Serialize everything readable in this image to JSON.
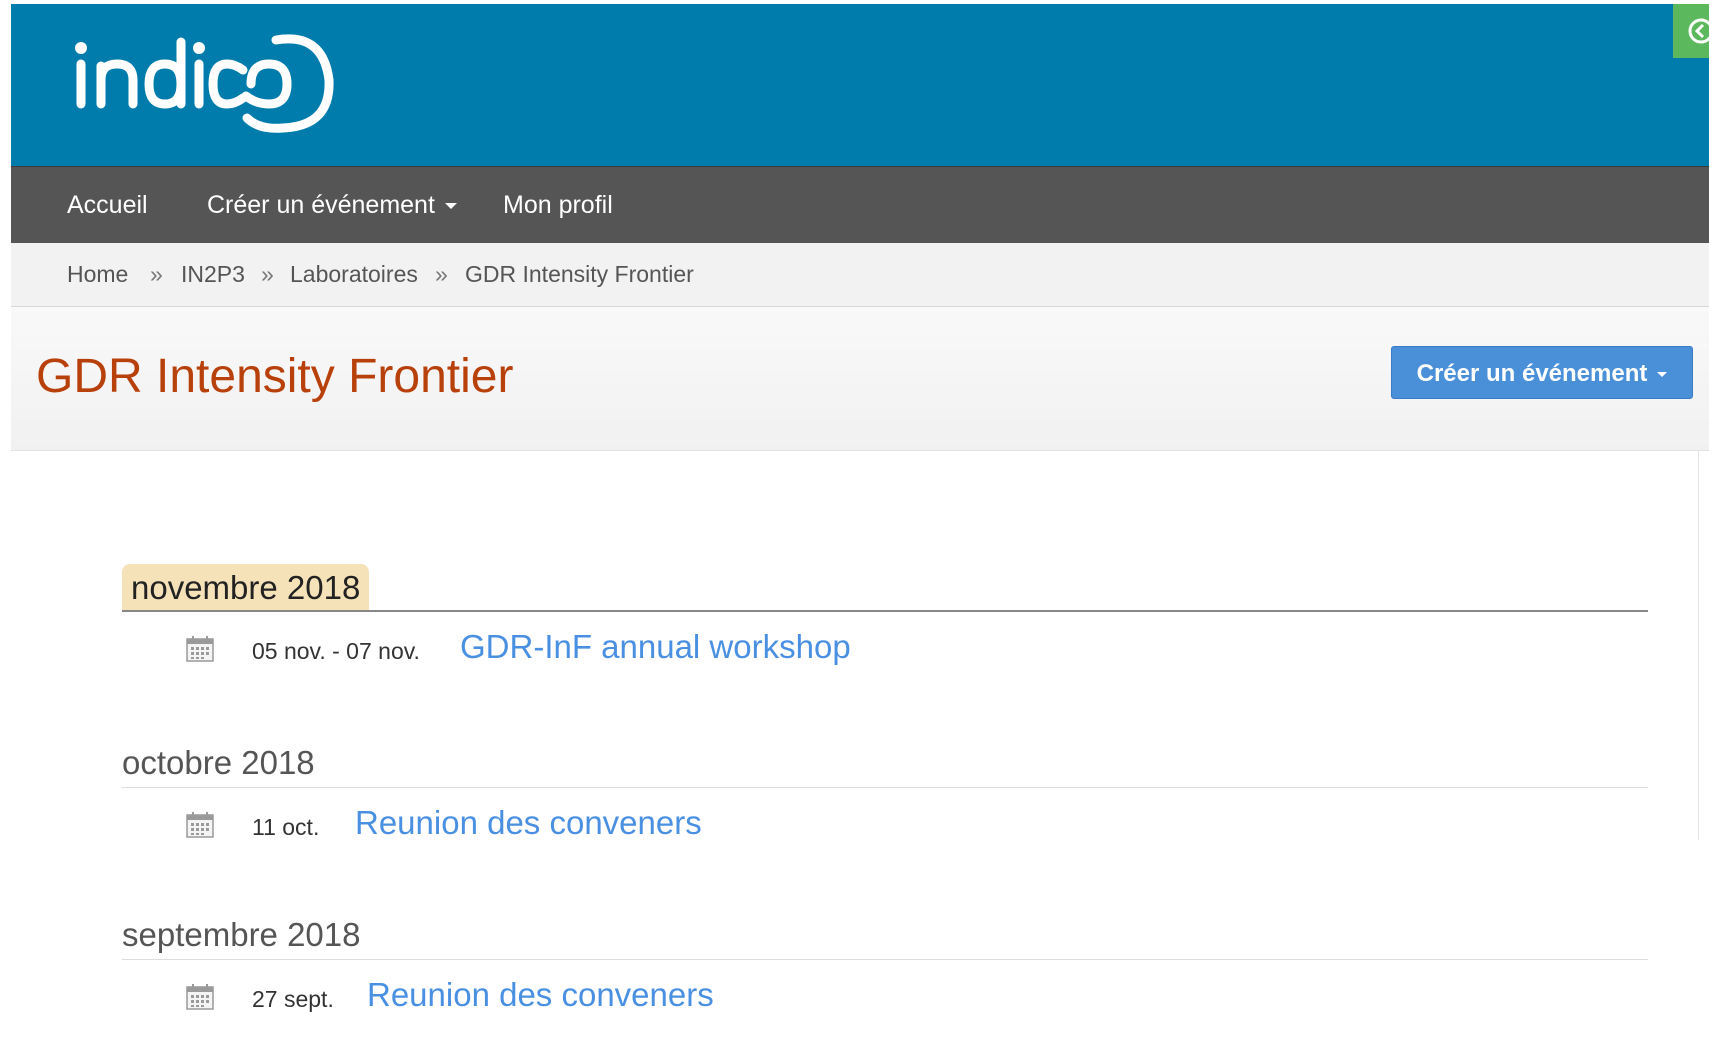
{
  "header": {
    "logo_text": "indico",
    "colors": {
      "header_bg": "#007cac",
      "nav_bg": "#555555",
      "accent_green": "#5cb85c"
    }
  },
  "nav": {
    "items": [
      {
        "label": "Accueil"
      },
      {
        "label": "Créer un événement",
        "has_dropdown": true
      },
      {
        "label": "Mon profil"
      }
    ]
  },
  "breadcrumb": {
    "items": [
      "Home",
      "IN2P3",
      "Laboratoires",
      "GDR Intensity Frontier"
    ],
    "separator": "»"
  },
  "category": {
    "title": "GDR Intensity Frontier",
    "title_color": "#b8400b",
    "create_button_label": "Créer un événement",
    "create_button_color": "#4a90d9"
  },
  "events": {
    "link_color": "#4a90e2",
    "months": [
      {
        "label": "novembre 2018",
        "current": true,
        "items": [
          {
            "date": "05 nov. - 07 nov.",
            "title": "GDR-InF annual workshop",
            "icon": "calendar-icon"
          }
        ]
      },
      {
        "label": "octobre 2018",
        "current": false,
        "items": [
          {
            "date": "11 oct.",
            "title": "Reunion des conveners",
            "icon": "calendar-icon"
          }
        ]
      },
      {
        "label": "septembre 2018",
        "current": false,
        "items": [
          {
            "date": "27 sept.",
            "title": "Reunion des conveners",
            "icon": "calendar-icon"
          }
        ]
      }
    ]
  }
}
